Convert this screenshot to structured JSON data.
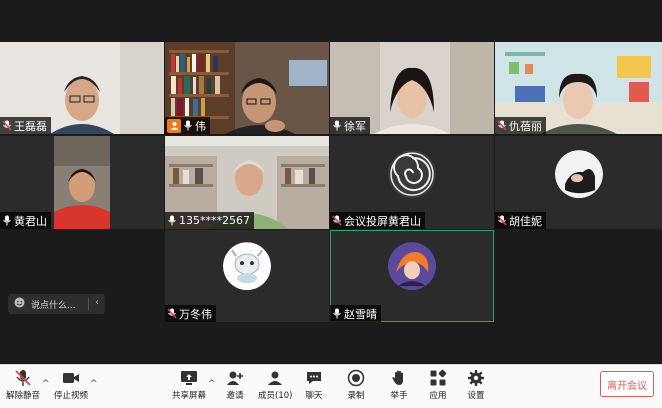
{
  "participants": [
    {
      "name": "王磊磊",
      "kind": "video",
      "mic": "muted"
    },
    {
      "name": "伟",
      "kind": "video",
      "mic": "on",
      "host": true
    },
    {
      "name": "徐军",
      "kind": "video",
      "mic": "on"
    },
    {
      "name": "仇蓓丽",
      "kind": "video",
      "mic": "muted"
    },
    {
      "name": "黄君山",
      "kind": "video",
      "mic": "on"
    },
    {
      "name": "135****2567",
      "kind": "video",
      "mic": "on"
    },
    {
      "name": "会议投屏黄君山",
      "kind": "avatar",
      "mic": "muted",
      "avatar": "swirl-logo"
    },
    {
      "name": "胡佳妮",
      "kind": "avatar",
      "mic": "muted",
      "avatar": "photo"
    },
    {
      "name": "万冬伟",
      "kind": "avatar",
      "mic": "muted",
      "avatar": "cartoon"
    },
    {
      "name": "赵雪晴",
      "kind": "avatar",
      "mic": "on",
      "avatar": "illustration",
      "speaking": true
    }
  ],
  "chat": {
    "placeholder": "说点什么..."
  },
  "toolbar": {
    "unmute": "解除静音",
    "stop_video": "停止视频",
    "share_screen": "共享屏幕",
    "invite": "邀请",
    "members": "成员(10)",
    "chat": "聊天",
    "record": "录制",
    "raise_hand": "举手",
    "apps": "应用",
    "settings": "设置",
    "leave": "离开会议"
  },
  "colors": {
    "accent_green": "#2ea56a",
    "leave_red": "#e15a5a",
    "host_orange": "#f07a19",
    "muted_red": "#e04848"
  }
}
